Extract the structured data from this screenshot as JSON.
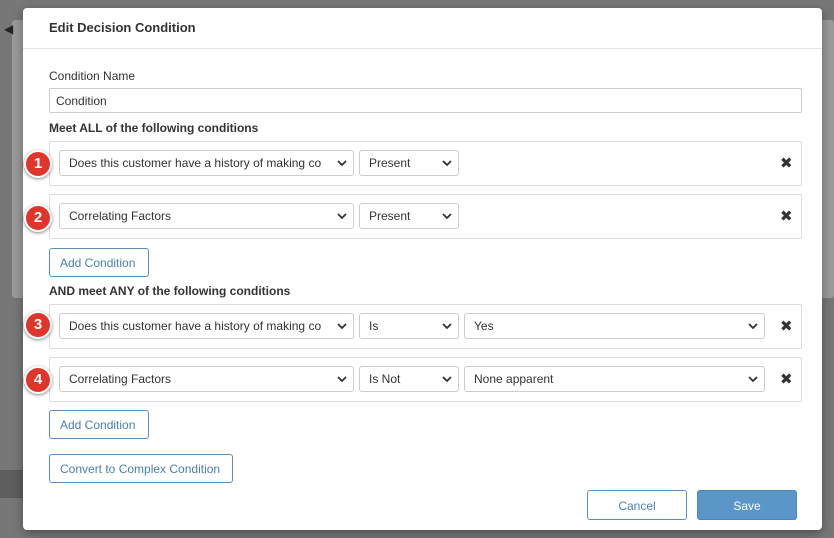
{
  "modal": {
    "title": "Edit Decision Condition",
    "condition_name_label": "Condition Name",
    "condition_name_value": "Condition"
  },
  "all_section": {
    "title": "Meet ALL of the following conditions",
    "rows": [
      {
        "badge": "1",
        "field": "Does this customer have a history of making co",
        "operator": "Present"
      },
      {
        "badge": "2",
        "field": "Correlating Factors",
        "operator": "Present"
      }
    ],
    "add_label": "Add Condition"
  },
  "any_section": {
    "title": "AND meet ANY of the following conditions",
    "rows": [
      {
        "badge": "3",
        "field": "Does this customer have a history of making co",
        "operator": "Is",
        "value": "Yes"
      },
      {
        "badge": "4",
        "field": "Correlating Factors",
        "operator": "Is Not",
        "value": "None apparent"
      }
    ],
    "add_label": "Add Condition"
  },
  "convert_label": "Convert to Complex Condition",
  "footer": {
    "cancel_label": "Cancel",
    "save_label": "Save"
  },
  "colors": {
    "badge": "#e0352b",
    "primary": "#5b96c8",
    "link": "#4a7fb0"
  },
  "icons": {
    "remove": "close-icon",
    "dropdown": "chevron-down-icon"
  }
}
